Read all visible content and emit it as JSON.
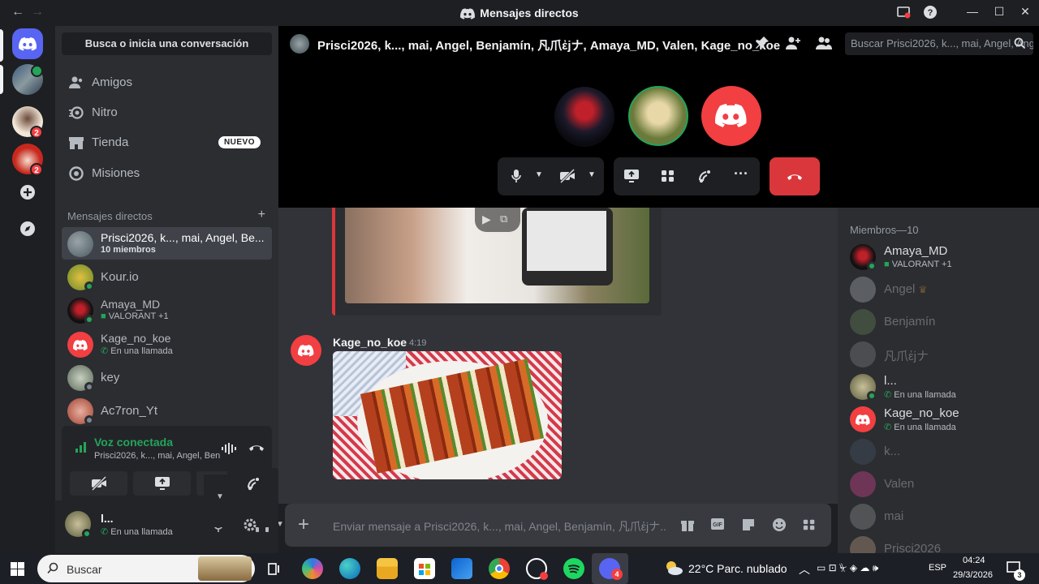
{
  "window": {
    "title": "Mensajes directos"
  },
  "sidebar": {
    "search_placeholder": "Busca o inicia una conversación",
    "nav": [
      {
        "label": "Amigos",
        "icon": "friends-icon"
      },
      {
        "label": "Nitro",
        "icon": "nitro-icon"
      },
      {
        "label": "Tienda",
        "icon": "shop-icon",
        "badge": "NUEVO"
      },
      {
        "label": "Misiones",
        "icon": "quests-icon"
      }
    ],
    "dm_header": "Mensajes directos",
    "dms": [
      {
        "name": "Prisci2026, k..., mai, Angel, Be...",
        "sub": "10 miembros"
      },
      {
        "name": "Kour.io"
      },
      {
        "name": "Amaya_MD",
        "sub": "VALORANT +1"
      },
      {
        "name": "Kage_no_koe",
        "sub": "En una llamada"
      },
      {
        "name": "key"
      },
      {
        "name": "Ac7ron_Yt"
      }
    ]
  },
  "rail": {
    "badges": [
      "2",
      "2"
    ]
  },
  "voice": {
    "title": "Voz conectada",
    "channel": "Prisci2026, k..., mai, Angel, Benjamín, ..."
  },
  "user": {
    "name": "l...",
    "status": "En una llamada"
  },
  "chat": {
    "name": "Prisci2026, k..., mai, Angel, Benjamín, 凡爪ἐjナ, Amaya_MD, Valen, Kage_no_koe",
    "search_placeholder": "Buscar Prisci2026, k..., mai, Angel, Ang..."
  },
  "message": {
    "author": "Kage_no_koe",
    "time": "4:19"
  },
  "composer": {
    "placeholder": "Enviar mensaje a Prisci2026, k..., mai, Angel, Benjamín, 凡爪ἐjナ..."
  },
  "members": {
    "header": "Miembros—10",
    "list": [
      {
        "name": "Amaya_MD",
        "sub": "VALORANT +1",
        "online": true
      },
      {
        "name": "Angel",
        "online": false
      },
      {
        "name": "Benjamín",
        "online": false
      },
      {
        "name": "凡爪ἐjナ",
        "online": false
      },
      {
        "name": "l...",
        "sub": "En una llamada",
        "online": true
      },
      {
        "name": "Kage_no_koe",
        "sub": "En una llamada",
        "online": true
      },
      {
        "name": "k...",
        "online": false
      },
      {
        "name": "Valen",
        "online": false
      },
      {
        "name": "mai",
        "online": false
      },
      {
        "name": "Prisci2026",
        "online": false
      }
    ]
  },
  "taskbar": {
    "search_placeholder": "Buscar",
    "weather": "22°C  Parc. nublado",
    "lang": "ESP",
    "time": "04:24",
    "date": "29/3/2026",
    "notif": "3",
    "discord_badge": "4"
  },
  "colors": {
    "accent": "#5865f2",
    "online": "#23a55a",
    "danger": "#da373c",
    "link": "#00a8fc"
  }
}
